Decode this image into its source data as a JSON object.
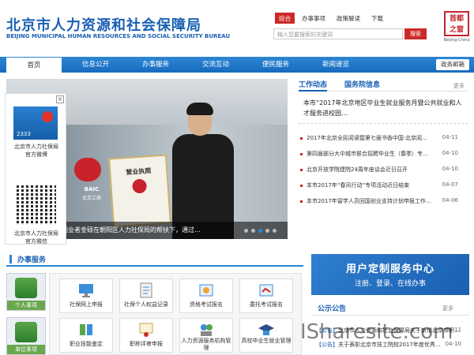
{
  "header": {
    "title_cn": "北京市人力资源和社会保障局",
    "title_en": "BEIJING MUNICIPAL HUMAN RESOURCES AND SOCIAL SECURITY BUREAU",
    "top_links": [
      "综合",
      "办事事项",
      "政策解读",
      "下载"
    ],
    "search_placeholder": "输入您要搜索的关键词",
    "search_button": "搜索",
    "logo_chars": [
      "首",
      "都",
      "之",
      "窗"
    ],
    "logo_caption": "Beijing-China"
  },
  "nav": {
    "items": [
      "首页",
      "信息公开",
      "办事服务",
      "交流互动",
      "便民服务",
      "新闻速览"
    ],
    "mailbox": "政务邮箱"
  },
  "banner": {
    "license_title": "营业执照",
    "sign_text": "BAIC",
    "sign_sub": "北京工商",
    "caption": "创业者金硕在朝阳区人力社保局的帮扶下，通过…",
    "slide_count": 5,
    "active_slide": 2
  },
  "float_panel": {
    "weibo_label": "2333",
    "weibo_caption": [
      "北京市人力社保局",
      "官方微博"
    ],
    "wechat_caption": [
      "北京市人力社保局",
      "官方微信"
    ],
    "close_icon": "close-icon"
  },
  "news": {
    "tabs": [
      "工作动态",
      "国务院信息"
    ],
    "more": "更多",
    "headline": "本市“2017年北京地区毕业生就业服务月暨公共就业和人才服务进校园…",
    "items": [
      {
        "title": "2017年北京全民阅读暨第七届书香中国·北京阅…",
        "date": "04-11"
      },
      {
        "title": "第四届部分大中城市联合招聘毕业生（春季）专…",
        "date": "04-10"
      },
      {
        "title": "北京开放学院建院24周年座谈会近日召开",
        "date": "04-10"
      },
      {
        "title": "本市2017年“春风行动”专项活动近日结束",
        "date": "04-07"
      },
      {
        "title": "本市2017年留学人员回国创业支持计划申报工作…",
        "date": "04-06"
      }
    ]
  },
  "services_section": {
    "title": "办事服务",
    "left_tabs": [
      "个人事项",
      "单位事项"
    ],
    "items": [
      {
        "label": "社保网上申报",
        "icon": "monitor-icon"
      },
      {
        "label": "社保个人权益记录",
        "icon": "document-icon"
      },
      {
        "label": "资格考试报名",
        "icon": "exam-icon"
      },
      {
        "label": "委托考试报名",
        "icon": "entrust-icon"
      },
      {
        "label": "职业技能鉴定",
        "icon": "book-icon"
      },
      {
        "label": "职称评审申报",
        "icon": "certificate-icon"
      },
      {
        "label": "人力资源服务机构管理",
        "icon": "agency-icon"
      },
      {
        "label": "高校毕业生就业管理",
        "icon": "graduate-icon"
      }
    ]
  },
  "promo": {
    "title": "用户定制服务中心",
    "subtitle": "注册、登录、在线办事"
  },
  "notice": {
    "title": "公示公告",
    "more": "更多",
    "items": [
      {
        "tag": "【公告】",
        "title": "北京市人力资源和社会保障局关于新增北京市职…",
        "date": "04-11"
      },
      {
        "tag": "【公告】",
        "title": "关于表彰北京市技工院校2017年度优秀…",
        "date": "04-10"
      }
    ]
  },
  "watermark": "ISharesite.com",
  "colors": {
    "brand_blue": "#1960b4",
    "nav_blue": "#2d86d4",
    "accent_red": "#cc2a28",
    "tab_green": "#6aa84f"
  }
}
